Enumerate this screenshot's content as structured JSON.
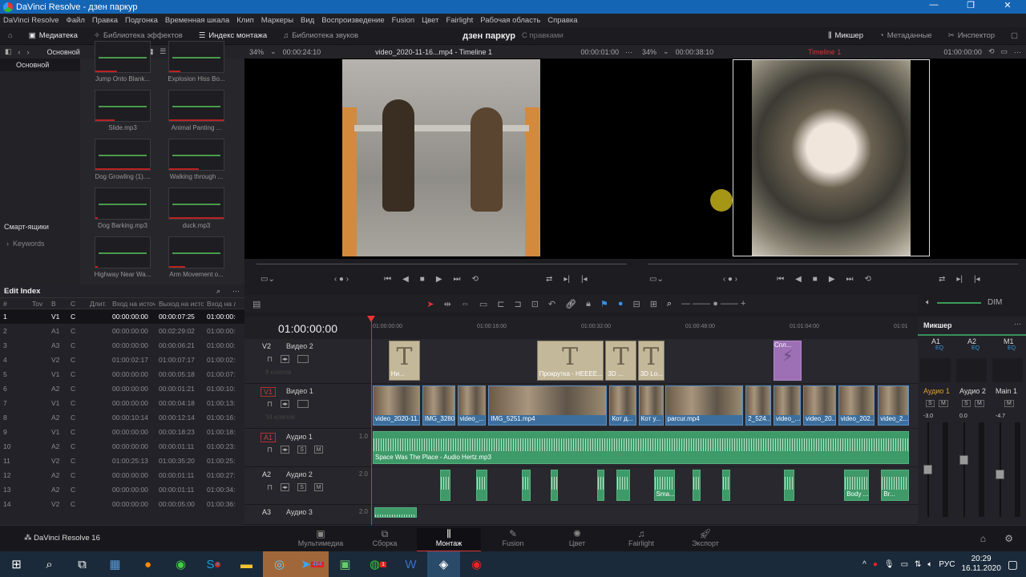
{
  "window": {
    "title": "DaVinci Resolve - дзен паркур",
    "min": "—",
    "max": "❐",
    "close": "✕"
  },
  "menu": [
    "DaVinci Resolve",
    "Файл",
    "Правка",
    "Подгонка",
    "Временная шкала",
    "Клип",
    "Маркеры",
    "Вид",
    "Воспроизведение",
    "Fusion",
    "Цвет",
    "Fairlight",
    "Рабочая область",
    "Справка"
  ],
  "toolbar": {
    "media": "Медиатека",
    "effects": "Библиотека эффектов",
    "index": "Индекс монтажа",
    "sounds": "Библиотека звуков",
    "project": "дзен паркур",
    "edited": "С правками",
    "mixer": "Микшер",
    "metadata": "Метаданные",
    "inspector": "Инспектор"
  },
  "pool": {
    "bin": "Основной",
    "bin_selected": "Основной",
    "smart_bins": "Смарт-ящики",
    "keywords": "Keywords",
    "clips": [
      "Jump Onto Blank...",
      "Explosion Hiss Bo...",
      "Slide.mp3",
      "Animal Panting ...",
      "Dog Growling (1)....",
      "Walking through ...",
      "Dog Barking.mp3",
      "duck.mp3",
      "Highway Near Wa...",
      "Arm Movement o..."
    ]
  },
  "source": {
    "zoom": "34%",
    "timecode": "00:00:24:10",
    "name": "video_2020-11-16...mp4 - Timeline 1",
    "duration": "00:00:01:00"
  },
  "program": {
    "zoom": "34%",
    "timecode": "00:00:38:10",
    "name": "Timeline 1",
    "position": "01:00:00:00"
  },
  "edit_index": {
    "title": "Edit Index",
    "columns": [
      "#",
      "Tov",
      "В",
      "С",
      "Длит.",
      "Вход на источ",
      "Выход на исто",
      "Вход на ли"
    ],
    "rows": [
      [
        "1",
        "V1",
        "C",
        "00:00:00:00",
        "00:00:07:25",
        "01:00:00:00"
      ],
      [
        "2",
        "A1",
        "C",
        "00:00:00:00",
        "00:02:29:02",
        "01:00:00:0"
      ],
      [
        "3",
        "A3",
        "C",
        "00:00:00:00",
        "00:00:06:21",
        "01:00:00:1"
      ],
      [
        "4",
        "V2",
        "C",
        "01:00:02:17",
        "01:00:07:17",
        "01:00:02:0"
      ],
      [
        "5",
        "V1",
        "C",
        "00:00:00:00",
        "00:00:05:18",
        "01:00:07:2"
      ],
      [
        "6",
        "A2",
        "C",
        "00:00:00:00",
        "00:00:01:21",
        "01:00:10:1"
      ],
      [
        "7",
        "V1",
        "C",
        "00:00:00:00",
        "00:00:04:18",
        "01:00:13:1"
      ],
      [
        "8",
        "A2",
        "C",
        "00:00:10:14",
        "00:00:12:14",
        "01:00:16:0"
      ],
      [
        "9",
        "V1",
        "C",
        "00:00:00:00",
        "00:00:18:23",
        "01:00:18:0"
      ],
      [
        "10",
        "A2",
        "C",
        "00:00:00:00",
        "00:00:01:11",
        "01:00:23:0"
      ],
      [
        "11",
        "V2",
        "C",
        "01:00:25:13",
        "01:00:35:20",
        "01:00:25:1"
      ],
      [
        "12",
        "A2",
        "C",
        "00:00:00:00",
        "00:00:01:11",
        "01:00:27:1"
      ],
      [
        "13",
        "A2",
        "C",
        "00:00:00:00",
        "00:00:01:11",
        "01:00:34:1"
      ],
      [
        "14",
        "V2",
        "C",
        "00:00:00:00",
        "00:00:05:00",
        "01:00:36:0"
      ]
    ]
  },
  "timeline": {
    "timecode": "01:00:00:00",
    "ruler": [
      "01:00:00:00",
      "01:00:16:00",
      "01:00:32:00",
      "01:00:48:00",
      "01:01:04:00",
      "01:01"
    ],
    "tracks": [
      {
        "id": "V2",
        "name": "Видео 2",
        "count": "8 клипов"
      },
      {
        "id": "V1",
        "name": "Видео 1",
        "count": "34 клипов"
      },
      {
        "id": "A1",
        "name": "Аудио 1",
        "level": "1.0"
      },
      {
        "id": "A2",
        "name": "Аудио 2",
        "level": "2.0"
      },
      {
        "id": "A3",
        "name": "Аудио 3",
        "level": "2.0"
      }
    ],
    "v2": [
      {
        "s": 2.4,
        "e": 7.3,
        "label": "Ни...",
        "kind": "title"
      },
      {
        "s": 24.8,
        "e": 35,
        "label": "Прокрутка - HEEEE...",
        "kind": "title"
      },
      {
        "s": 35.2,
        "e": 40,
        "label": "3D ...",
        "kind": "title"
      },
      {
        "s": 40.1,
        "e": 44.2,
        "label": "3D Lo...",
        "kind": "title"
      },
      {
        "s": 60.6,
        "e": 65,
        "label": "Спл...",
        "kind": "transition"
      }
    ],
    "v1": [
      {
        "s": 0,
        "e": 7.3,
        "label": "video_2020-11..."
      },
      {
        "s": 7.5,
        "e": 12.6,
        "label": "IMG_3280..."
      },
      {
        "s": 12.8,
        "e": 17.2,
        "label": "video_..."
      },
      {
        "s": 17.5,
        "e": 35.5,
        "label": "IMG_5251.mp4"
      },
      {
        "s": 35.8,
        "e": 40,
        "label": "Кот д..."
      },
      {
        "s": 40.2,
        "e": 44.1,
        "label": "Кот у..."
      },
      {
        "s": 44.2,
        "e": 56.1,
        "label": "parcur.mp4"
      },
      {
        "s": 56.4,
        "e": 60.4,
        "label": "2_524..."
      },
      {
        "s": 60.6,
        "e": 64.8,
        "label": "video_..."
      },
      {
        "s": 65.1,
        "e": 70.2,
        "label": "video_20..."
      },
      {
        "s": 70.4,
        "e": 76,
        "label": "video_202..."
      },
      {
        "s": 76.4,
        "e": 81.2,
        "label": "video_2..."
      }
    ],
    "a1": [
      {
        "s": 0,
        "e": 81.2,
        "label": "Space Was The Place - Audio Hertz.mp3"
      }
    ],
    "a2": [
      {
        "s": 10.2,
        "e": 11.9,
        "label": ""
      },
      {
        "s": 15.6,
        "e": 17.5,
        "label": ""
      },
      {
        "s": 22.6,
        "e": 24,
        "label": ""
      },
      {
        "s": 26.9,
        "e": 28.1,
        "label": ""
      },
      {
        "s": 33.9,
        "e": 35.2,
        "label": ""
      },
      {
        "s": 36.8,
        "e": 39,
        "label": ""
      },
      {
        "s": 42.5,
        "e": 45.8,
        "label": "Sma..."
      },
      {
        "s": 48.4,
        "e": 49.7,
        "label": ""
      },
      {
        "s": 52.8,
        "e": 54.2,
        "label": ""
      },
      {
        "s": 62.2,
        "e": 63.9,
        "label": ""
      },
      {
        "s": 71.3,
        "e": 75.2,
        "label": "Body ..."
      },
      {
        "s": 76.9,
        "e": 81.2,
        "label": "Br..."
      }
    ],
    "a3": [
      {
        "s": 0.2,
        "e": 6.8,
        "label": ""
      }
    ]
  },
  "mixer": {
    "title": "Микшер",
    "channels": [
      {
        "bus": "A1",
        "name": "Аудио 1",
        "db": "-3.0",
        "level": 0.55
      },
      {
        "bus": "A2",
        "name": "Аудио 2",
        "db": "0.0",
        "level": 0.65
      },
      {
        "bus": "M1",
        "name": "Main 1",
        "db": "-4.7",
        "level": 0.5
      }
    ],
    "eq": "EQ",
    "solo": "S",
    "mute": "M"
  },
  "pages": {
    "product": "DaVinci Resolve 16",
    "items": [
      "Мультимедиа",
      "Сборка",
      "Монтаж",
      "Fusion",
      "Цвет",
      "Fairlight",
      "Экспорт"
    ],
    "active": "Монтаж"
  },
  "taskbar": {
    "lang": "РУС",
    "time": "20:29",
    "date": "16.11.2020",
    "badges": [
      "4",
      "484",
      "1"
    ]
  },
  "colors": {
    "accent": "#d83030",
    "video_clip": "#3c6f9e",
    "audio_clip": "#3e9a68",
    "title_clip": "#c4b89a"
  }
}
